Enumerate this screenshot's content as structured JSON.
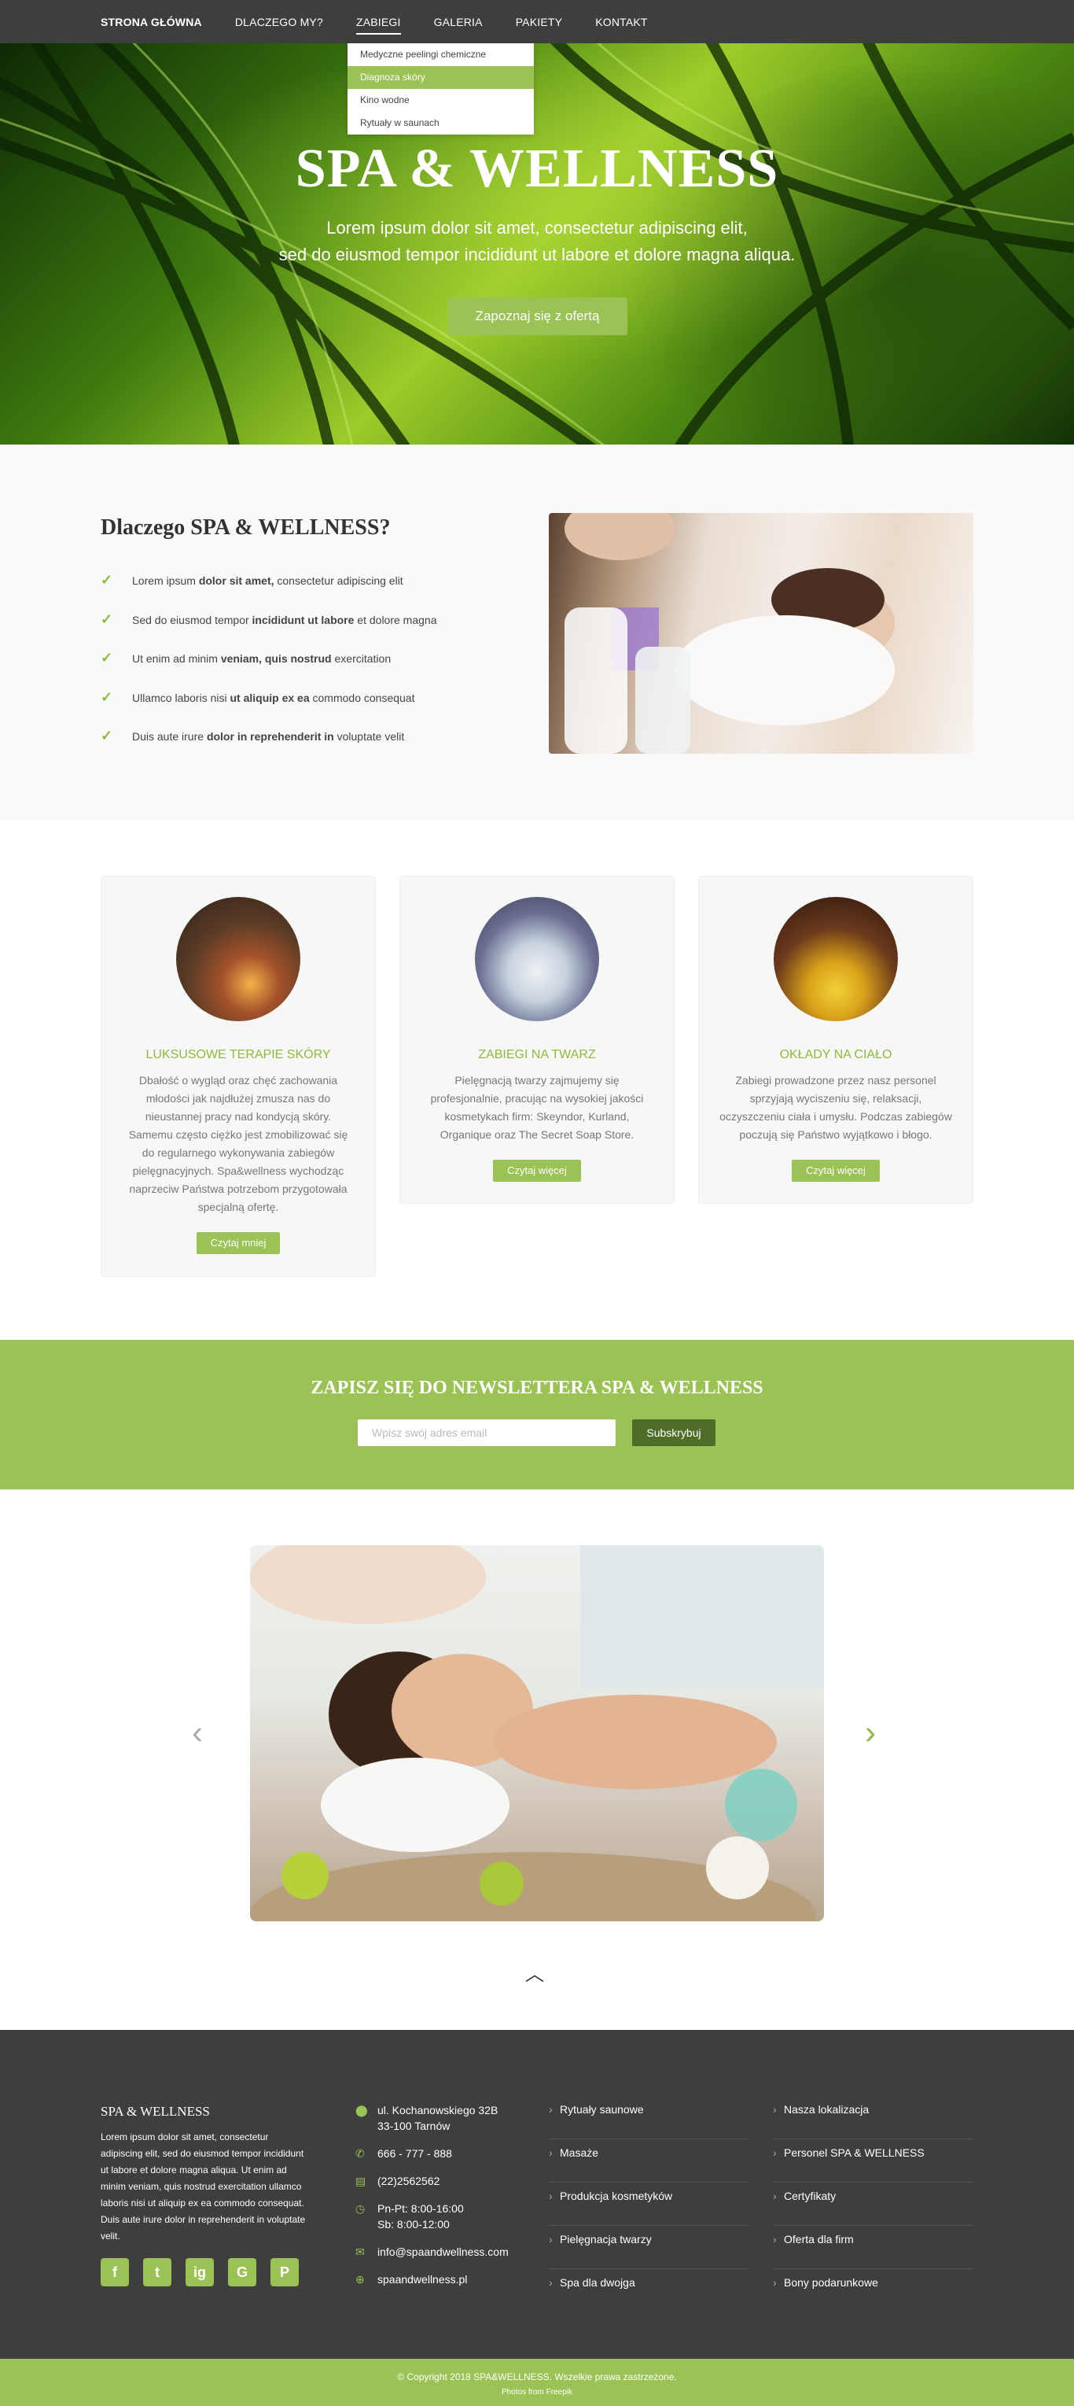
{
  "nav": {
    "items": [
      "STRONA GŁÓWNA",
      "DLACZEGO MY?",
      "ZABIEGI",
      "GALERIA",
      "PAKIETY",
      "KONTAKT"
    ],
    "dropdown": [
      "Medyczne peelingi chemiczne",
      "Diagnoza skóry",
      "Kino wodne",
      "Rytuały w saunach"
    ]
  },
  "hero": {
    "title": "SPA & WELLNESS",
    "line1": "Lorem ipsum dolor sit amet, consectetur adipiscing elit,",
    "line2": "sed do eiusmod tempor incididunt ut labore et dolore magna aliqua.",
    "cta": "Zapoznaj się z ofertą"
  },
  "why": {
    "title": "Dlaczego SPA & WELLNESS?",
    "items": [
      {
        "a": "Lorem ipsum ",
        "b": "dolor sit amet,",
        "c": " consectetur adipiscing elit"
      },
      {
        "a": "Sed do eiusmod tempor ",
        "b": "incididunt ut labore",
        "c": " et dolore magna"
      },
      {
        "a": "Ut enim ad minim ",
        "b": "veniam, quis nostrud",
        "c": " exercitation"
      },
      {
        "a": "Ullamco laboris nisi ",
        "b": "ut aliquip ex ea",
        "c": " commodo consequat"
      },
      {
        "a": "Duis aute irure ",
        "b": "dolor in reprehenderit in",
        "c": " voluptate velit"
      }
    ]
  },
  "cards": [
    {
      "title": "LUKSUSOWE TERAPIE SKÓRY",
      "text": "Dbałość o wygląd oraz chęć zachowania młodości jak najdłużej zmusza nas do nieustannej pracy nad kondycją skóry. Samemu często ciężko jest zmobilizować się do regularnego wykonywania zabiegów pielęgnacyjnych. Spa&wellness wychodząc naprzeciw Państwa potrzebom przygotowała specjalną ofertę.",
      "button": "Czytaj mniej"
    },
    {
      "title": "ZABIEGI NA TWARZ",
      "text": "Pielęgnacją twarzy zajmujemy się profesjonalnie, pracując na wysokiej jakości kosmetykach firm: Skeyndor, Kurland, Organique oraz The Secret Soap Store.",
      "button": "Czytaj więcej"
    },
    {
      "title": "OKŁADY NA CIAŁO",
      "text": "Zabiegi prowadzone przez nasz personel sprzyjają wyciszeniu się, relaksacji, oczyszczeniu ciała i umysłu. Podczas zabiegów poczują się Państwo wyjątkowo i błogo.",
      "button": "Czytaj więcej"
    }
  ],
  "newsletter": {
    "title": "ZAPISZ SIĘ DO NEWSLETTERA SPA & WELLNESS",
    "placeholder": "Wpisz swój adres email",
    "button": "Subskrybuj"
  },
  "footer": {
    "brand": "SPA & WELLNESS",
    "about": "Lorem ipsum dolor sit amet, consectetur adipiscing elit, sed do eiusmod tempor incididunt ut labore et dolore magna aliqua. Ut enim ad minim veniam, quis nostrud exercitation ullamco laboris nisi ut aliquip ex ea commodo consequat. Duis aute irure dolor in reprehenderit in voluptate velit.",
    "social": [
      "f",
      "t",
      "ig",
      "G",
      "P"
    ],
    "address1": "ul. Kochanowskiego 32B",
    "address2": "33-100 Tarnów",
    "phone": "666 - 777 - 888",
    "fax": "(22)2562562",
    "hours1": "Pn-Pt: 8:00-16:00",
    "hours2": "Sb: 8:00-12:00",
    "email": "info@spaandwellness.com",
    "www": "spaandwellness.pl",
    "col1": [
      "Rytuały saunowe",
      "Masaże",
      "Produkcja kosmetyków",
      "Pielęgnacja twarzy",
      "Spa dla dwojga"
    ],
    "col2": [
      "Nasza lokalizacja",
      "Personel SPA & WELLNESS",
      "Certyfikaty",
      "Oferta dla firm",
      "Bony podarunkowe"
    ]
  },
  "copyright": {
    "line1": "© Copyright 2018 SPA&WELLNESS. Wszelkie prawa zastrzeżone.",
    "line2": "Photos from Freepik"
  },
  "colors": {
    "accent": "#9bc255",
    "dark": "#3e3e3e"
  }
}
